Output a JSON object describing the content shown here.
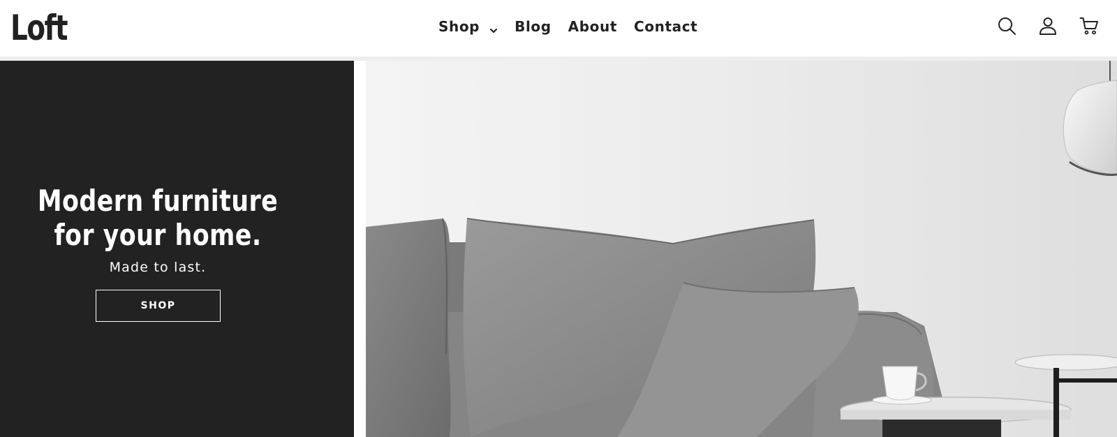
{
  "header": {
    "logo": "Loft",
    "nav": [
      {
        "label": "Shop",
        "has_dropdown": true
      },
      {
        "label": "Blog"
      },
      {
        "label": "About"
      },
      {
        "label": "Contact"
      }
    ],
    "icons": [
      "search-icon",
      "account-icon",
      "cart-icon"
    ]
  },
  "hero": {
    "title": "Modern furniture for your home.",
    "subtitle": "Made to last.",
    "button_label": "SHOP",
    "panel_color": "#222222",
    "image_subject": "grey sofa with cushions, pendant lamp and side table with a cup"
  },
  "colors": {
    "text_dark": "#222222",
    "background": "#ffffff",
    "divider": "#eeeeee"
  }
}
